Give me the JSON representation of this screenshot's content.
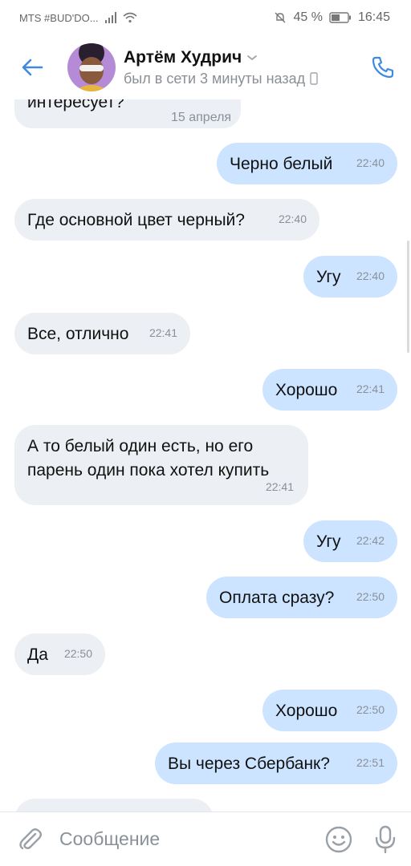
{
  "status_bar": {
    "carrier": "MTS #BUD'DO...",
    "battery": "45 %",
    "time": "16:45"
  },
  "header": {
    "name": "Артём Худрич",
    "status": "был в сети 3 минуты назад"
  },
  "messages": [
    {
      "dir": "in",
      "text": "интересует?",
      "time": ""
    },
    {
      "dir": "out",
      "text": "Черно белый",
      "time": "22:40"
    },
    {
      "dir": "in",
      "text": "Где основной цвет черный?",
      "time": "22:40"
    },
    {
      "dir": "out",
      "text": "Угу",
      "time": "22:40"
    },
    {
      "dir": "in",
      "text": "Все, отлично",
      "time": "22:41"
    },
    {
      "dir": "out",
      "text": "Хорошо",
      "time": "22:41"
    },
    {
      "dir": "in",
      "line1": "А то белый один есть, но его",
      "line2": "парень один пока хотел купить",
      "time": "22:41"
    },
    {
      "dir": "out",
      "text": "Угу",
      "time": "22:42"
    },
    {
      "dir": "out",
      "text": "Оплата сразу?",
      "time": "22:50"
    },
    {
      "dir": "in",
      "text": "Да",
      "time": "22:50"
    },
    {
      "dir": "out",
      "text": "Хорошо",
      "time": "22:50"
    },
    {
      "dir": "out",
      "text": "Вы через Сбербанк?",
      "time": "22:51"
    }
  ],
  "date_separator": "15 апреля",
  "input": {
    "placeholder": "Сообщение"
  },
  "colors": {
    "accent": "#3f8ae0",
    "incoming_bubble": "#eceff3",
    "outgoing_bubble": "#cce4ff"
  }
}
